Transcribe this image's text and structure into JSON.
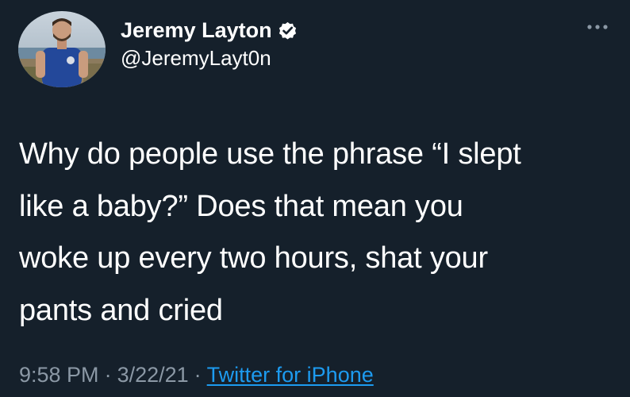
{
  "author": {
    "display_name": "Jeremy Layton",
    "handle": "@JeremyLayt0n",
    "verified": true,
    "avatar_icon": "profile-photo"
  },
  "tweet": {
    "text": "Why do people use the phrase “I slept\nlike a baby?” Does that mean you\nwoke up every two hours, shat your\npants and cried",
    "time": "9:58 PM",
    "date": "3/22/21",
    "separator": "·",
    "source": "Twitter for iPhone"
  },
  "icons": {
    "more": "more-options-icon",
    "verified": "verified-badge-icon"
  },
  "colors": {
    "background": "#15202b",
    "text": "#ffffff",
    "secondary_text": "#8b98a5",
    "link": "#1d9bf0"
  }
}
